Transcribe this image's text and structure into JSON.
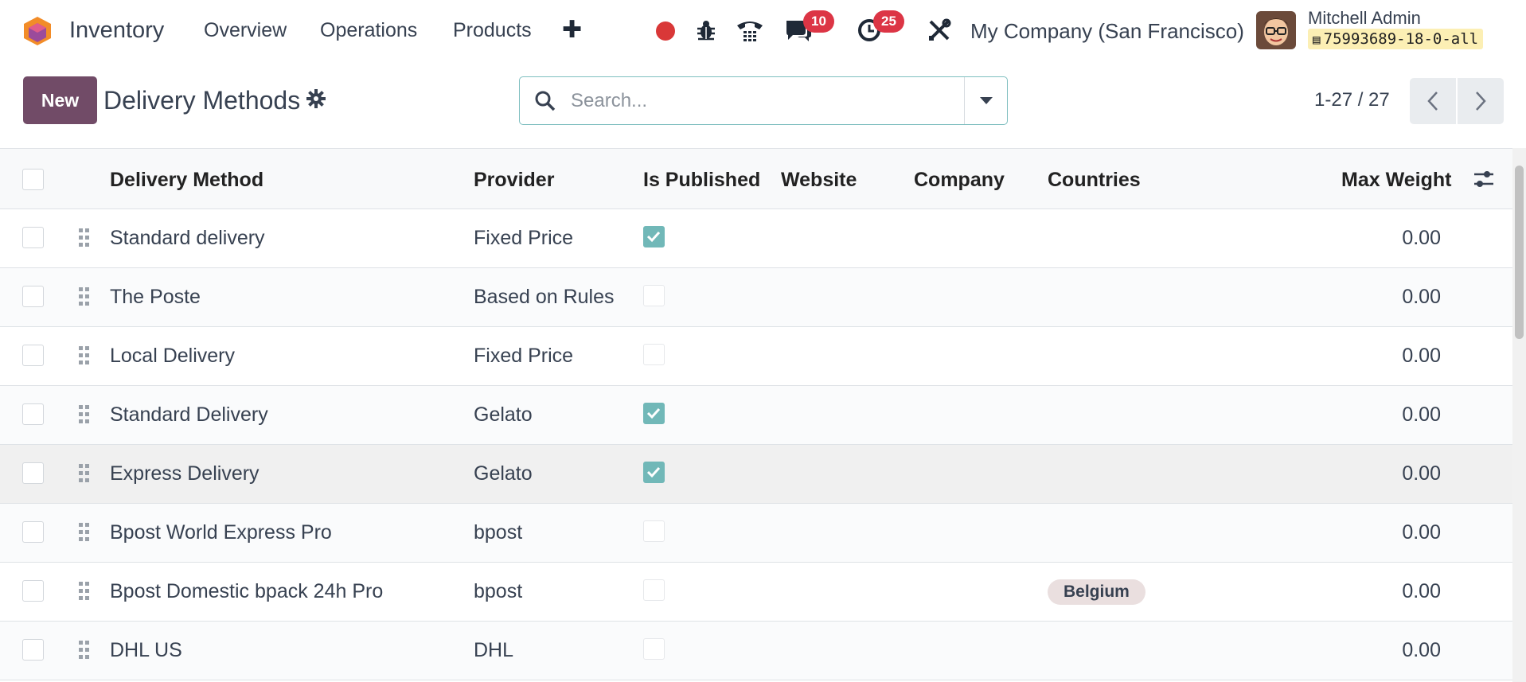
{
  "navbar": {
    "app_name": "Inventory",
    "menu": [
      "Overview",
      "Operations",
      "Products"
    ],
    "plus": "✚",
    "messages_count": "10",
    "activities_count": "25",
    "company": "My Company (San Francisco)",
    "user_name": "Mitchell Admin",
    "db_name": "75993689-18-0-all"
  },
  "control": {
    "new_label": "New",
    "breadcrumb": "Delivery Methods",
    "search_placeholder": "Search...",
    "pager": "1-27 / 27"
  },
  "table": {
    "headers": [
      "Delivery Method",
      "Provider",
      "Is Published",
      "Website",
      "Company",
      "Countries",
      "Max Weight"
    ],
    "rows": [
      {
        "name": "Standard delivery",
        "provider": "Fixed Price",
        "published": true,
        "country": "",
        "max_weight": "0.00"
      },
      {
        "name": "The Poste",
        "provider": "Based on Rules",
        "published": false,
        "country": "",
        "max_weight": "0.00"
      },
      {
        "name": "Local Delivery",
        "provider": "Fixed Price",
        "published": false,
        "country": "",
        "max_weight": "0.00"
      },
      {
        "name": "Standard Delivery",
        "provider": "Gelato",
        "published": true,
        "country": "",
        "max_weight": "0.00"
      },
      {
        "name": "Express Delivery",
        "provider": "Gelato",
        "published": true,
        "country": "",
        "max_weight": "0.00"
      },
      {
        "name": "Bpost World Express Pro",
        "provider": "bpost",
        "published": false,
        "country": "",
        "max_weight": "0.00"
      },
      {
        "name": "Bpost Domestic bpack 24h Pro",
        "provider": "bpost",
        "published": false,
        "country": "Belgium",
        "max_weight": "0.00"
      },
      {
        "name": "DHL US",
        "provider": "DHL",
        "published": false,
        "country": "",
        "max_weight": "0.00"
      }
    ]
  },
  "colors": {
    "brand": "#714b67",
    "badge": "#dc3545",
    "checked": "#71b8b8",
    "search_border": "#7fbfc0"
  },
  "icons": [
    "odoo-logo-icon",
    "record-icon",
    "bug-icon",
    "phone-icon",
    "chat-icon",
    "clock-icon",
    "tools-icon",
    "database-icon",
    "gear-icon",
    "search-icon",
    "caret-down-icon",
    "chevron-left-icon",
    "chevron-right-icon",
    "drag-handle-icon",
    "column-settings-icon"
  ]
}
